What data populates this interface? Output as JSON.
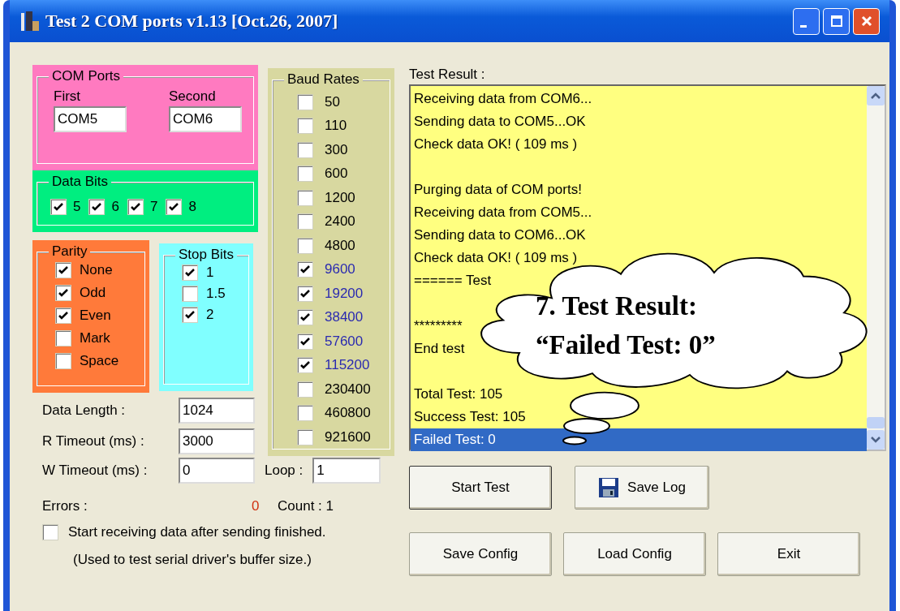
{
  "window": {
    "title": "Test 2 COM ports v1.13 [Oct.26, 2007]"
  },
  "com_ports": {
    "title": "COM Ports",
    "first": {
      "label": "First",
      "value": "COM5"
    },
    "second": {
      "label": "Second",
      "value": "COM6"
    }
  },
  "data_bits": {
    "title": "Data Bits",
    "options": [
      {
        "label": "5",
        "checked": true
      },
      {
        "label": "6",
        "checked": true
      },
      {
        "label": "7",
        "checked": true
      },
      {
        "label": "8",
        "checked": true
      }
    ]
  },
  "parity": {
    "title": "Parity",
    "options": [
      {
        "label": "None",
        "checked": true
      },
      {
        "label": "Odd",
        "checked": true
      },
      {
        "label": "Even",
        "checked": true
      },
      {
        "label": "Mark",
        "checked": false
      },
      {
        "label": "Space",
        "checked": false
      }
    ]
  },
  "stop_bits": {
    "title": "Stop Bits",
    "options": [
      {
        "label": "1",
        "checked": true
      },
      {
        "label": "1.5",
        "checked": false
      },
      {
        "label": "2",
        "checked": true
      }
    ]
  },
  "baud_rates": {
    "title": "Baud Rates",
    "options": [
      {
        "label": "50",
        "checked": false
      },
      {
        "label": "110",
        "checked": false
      },
      {
        "label": "300",
        "checked": false
      },
      {
        "label": "600",
        "checked": false
      },
      {
        "label": "1200",
        "checked": false
      },
      {
        "label": "2400",
        "checked": false
      },
      {
        "label": "4800",
        "checked": false
      },
      {
        "label": "9600",
        "checked": true
      },
      {
        "label": "19200",
        "checked": true
      },
      {
        "label": "38400",
        "checked": true
      },
      {
        "label": "57600",
        "checked": true
      },
      {
        "label": "115200",
        "checked": true
      },
      {
        "label": "230400",
        "checked": false
      },
      {
        "label": "460800",
        "checked": false
      },
      {
        "label": "921600",
        "checked": false
      }
    ]
  },
  "fields": [
    {
      "label": "Data Length :",
      "value": "1024"
    },
    {
      "label": "R Timeout (ms) :",
      "value": "3000"
    },
    {
      "label": "W Timeout (ms) :",
      "value": "0"
    }
  ],
  "loop": {
    "label": "Loop :",
    "value": "1"
  },
  "errors": {
    "label": "Errors :",
    "value": "0"
  },
  "count": "Count : 1",
  "receive_after_send": {
    "label": "Start receiving data after sending finished.",
    "checked": false
  },
  "note": "(Used to test serial driver's buffer size.)",
  "test_result": {
    "label": "Test Result :",
    "lines": [
      {
        "kind": "text",
        "text": "Receiving data from COM6...",
        "selected": false
      },
      {
        "kind": "text",
        "text": "Sending data to COM5...OK",
        "selected": false
      },
      {
        "kind": "text",
        "text": "Check data OK! ( 109 ms )",
        "selected": false
      },
      {
        "kind": "blank"
      },
      {
        "kind": "text",
        "text": "Purging data of COM ports!",
        "selected": false
      },
      {
        "kind": "text",
        "text": "Receiving data from COM5...",
        "selected": false
      },
      {
        "kind": "text",
        "text": "Sending data to COM6...OK",
        "selected": false
      },
      {
        "kind": "text",
        "text": "Check data OK! ( 109 ms )",
        "selected": false
      },
      {
        "kind": "text",
        "text": "====== Test",
        "selected": false
      },
      {
        "kind": "blank"
      },
      {
        "kind": "text",
        "text": "*********",
        "selected": false
      },
      {
        "kind": "text",
        "text": "End test",
        "selected": false
      },
      {
        "kind": "blank"
      },
      {
        "kind": "text",
        "text": "Total Test: 105",
        "selected": false
      },
      {
        "kind": "text",
        "text": "Success Test: 105",
        "selected": false
      },
      {
        "kind": "text",
        "text": "Failed Test: 0",
        "selected": true
      }
    ]
  },
  "button_rows": [
    [
      {
        "label": "Start Test",
        "kind": "plain"
      },
      {
        "label": "Save Log",
        "kind": "save"
      }
    ],
    [
      {
        "label": "Save Config",
        "kind": "plain"
      },
      {
        "label": "Load Config",
        "kind": "plain"
      },
      {
        "label": "Exit",
        "kind": "plain"
      }
    ]
  ],
  "callout": {
    "lines": [
      "7. Test Result:",
      "“Failed Test: 0”"
    ]
  }
}
